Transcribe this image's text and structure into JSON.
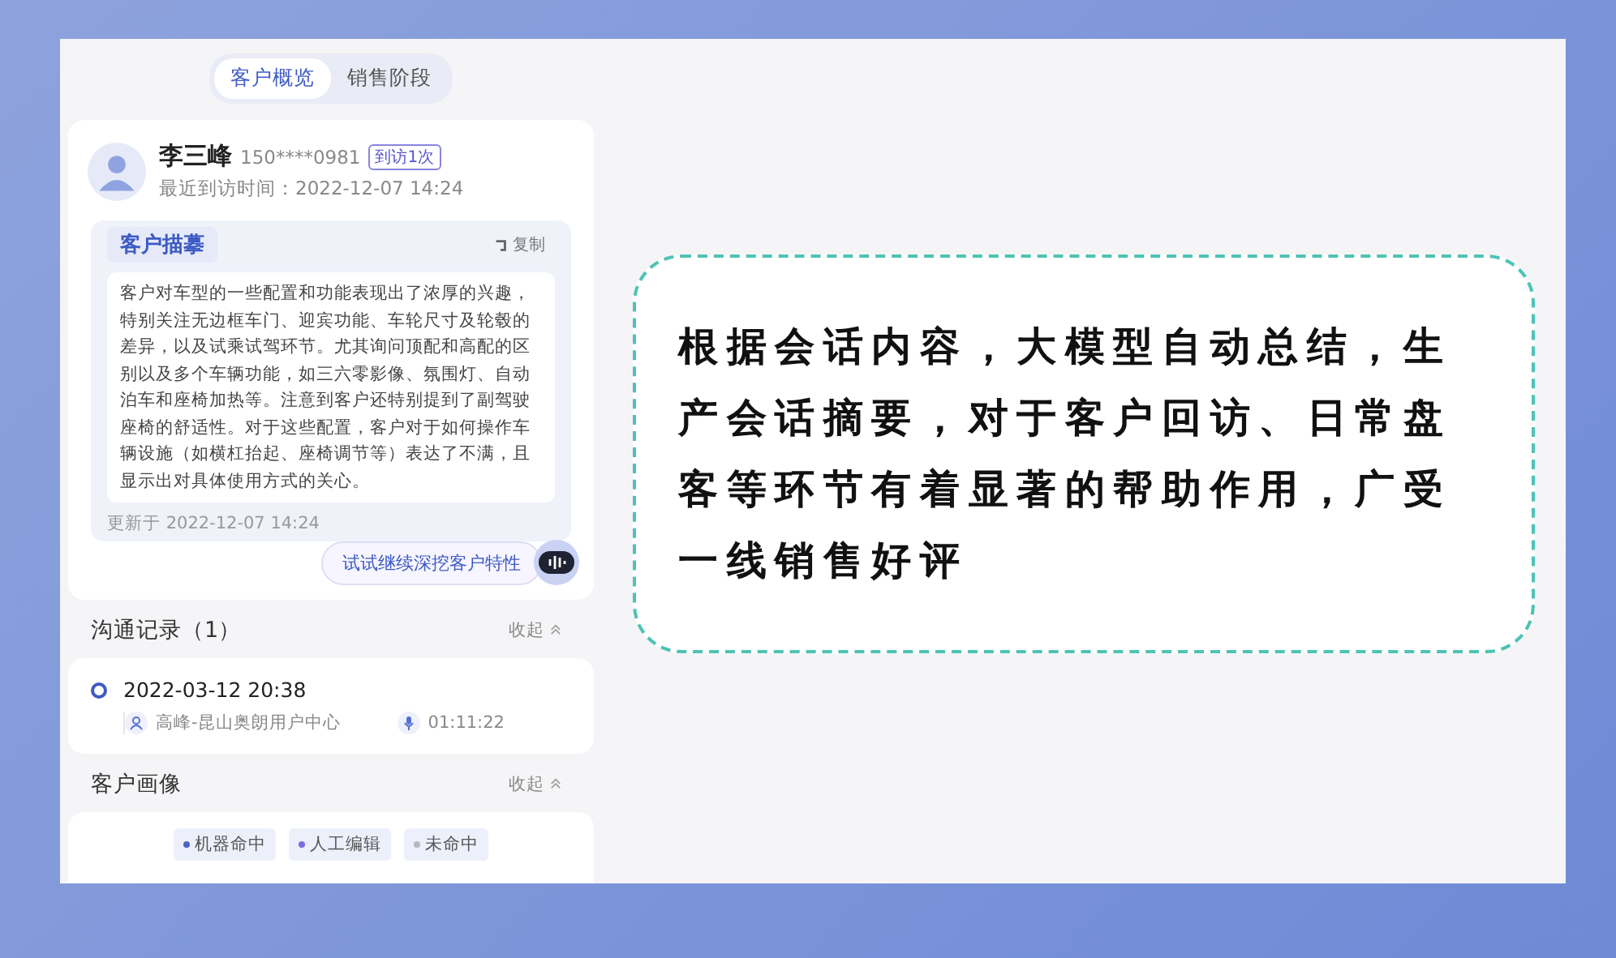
{
  "tabs": [
    {
      "label": "客户概览",
      "selected": true
    },
    {
      "label": "销售阶段",
      "selected": false
    }
  ],
  "customer": {
    "name": "李三峰",
    "phone": "150****0981",
    "visit_badge": "到访1次",
    "last_visit_label": "最近到访时间：",
    "last_visit": "2022-12-07 14:24"
  },
  "portrait": {
    "title": "客户描摹",
    "copy": "复制",
    "text": "客户对车型的一些配置和功能表现出了浓厚的兴趣，特别关注无边框车门、迎宾功能、车轮尺寸及轮毂的差异，以及试乘试驾环节。尤其询问顶配和高配的区别以及多个车辆功能，如三六零影像、氛围灯、自动泊车和座椅加热等。注意到客户还特别提到了副驾驶座椅的舒适性。对于这些配置，客户对于如何操作车辆设施（如横杠抬起、座椅调节等）表达了不满，且显示出对具体使用方式的关心。",
    "updated": "更新于 2022-12-07 14:24",
    "assistant_prompt": "试试继续深挖客户特性"
  },
  "records": {
    "title": "沟通记录（1）",
    "collapse": "收起",
    "items": [
      {
        "time": "2022-03-12  20:38",
        "person": "高峰-昆山奥朗用户中心",
        "duration": "01:11:22"
      }
    ]
  },
  "profile": {
    "title": "客户画像",
    "collapse": "收起",
    "legend": [
      {
        "label": "机器命中",
        "color": "#4a63c8"
      },
      {
        "label": "人工编辑",
        "color": "#7b6ee0"
      },
      {
        "label": "未命中",
        "color": "#b5b8c2"
      }
    ]
  },
  "callout": {
    "text": "根据会话内容，大模型自动总结，生产会话摘要，对于客户回访、日常盘客等环节有着显著的帮助作用，广受一线销售好评"
  }
}
